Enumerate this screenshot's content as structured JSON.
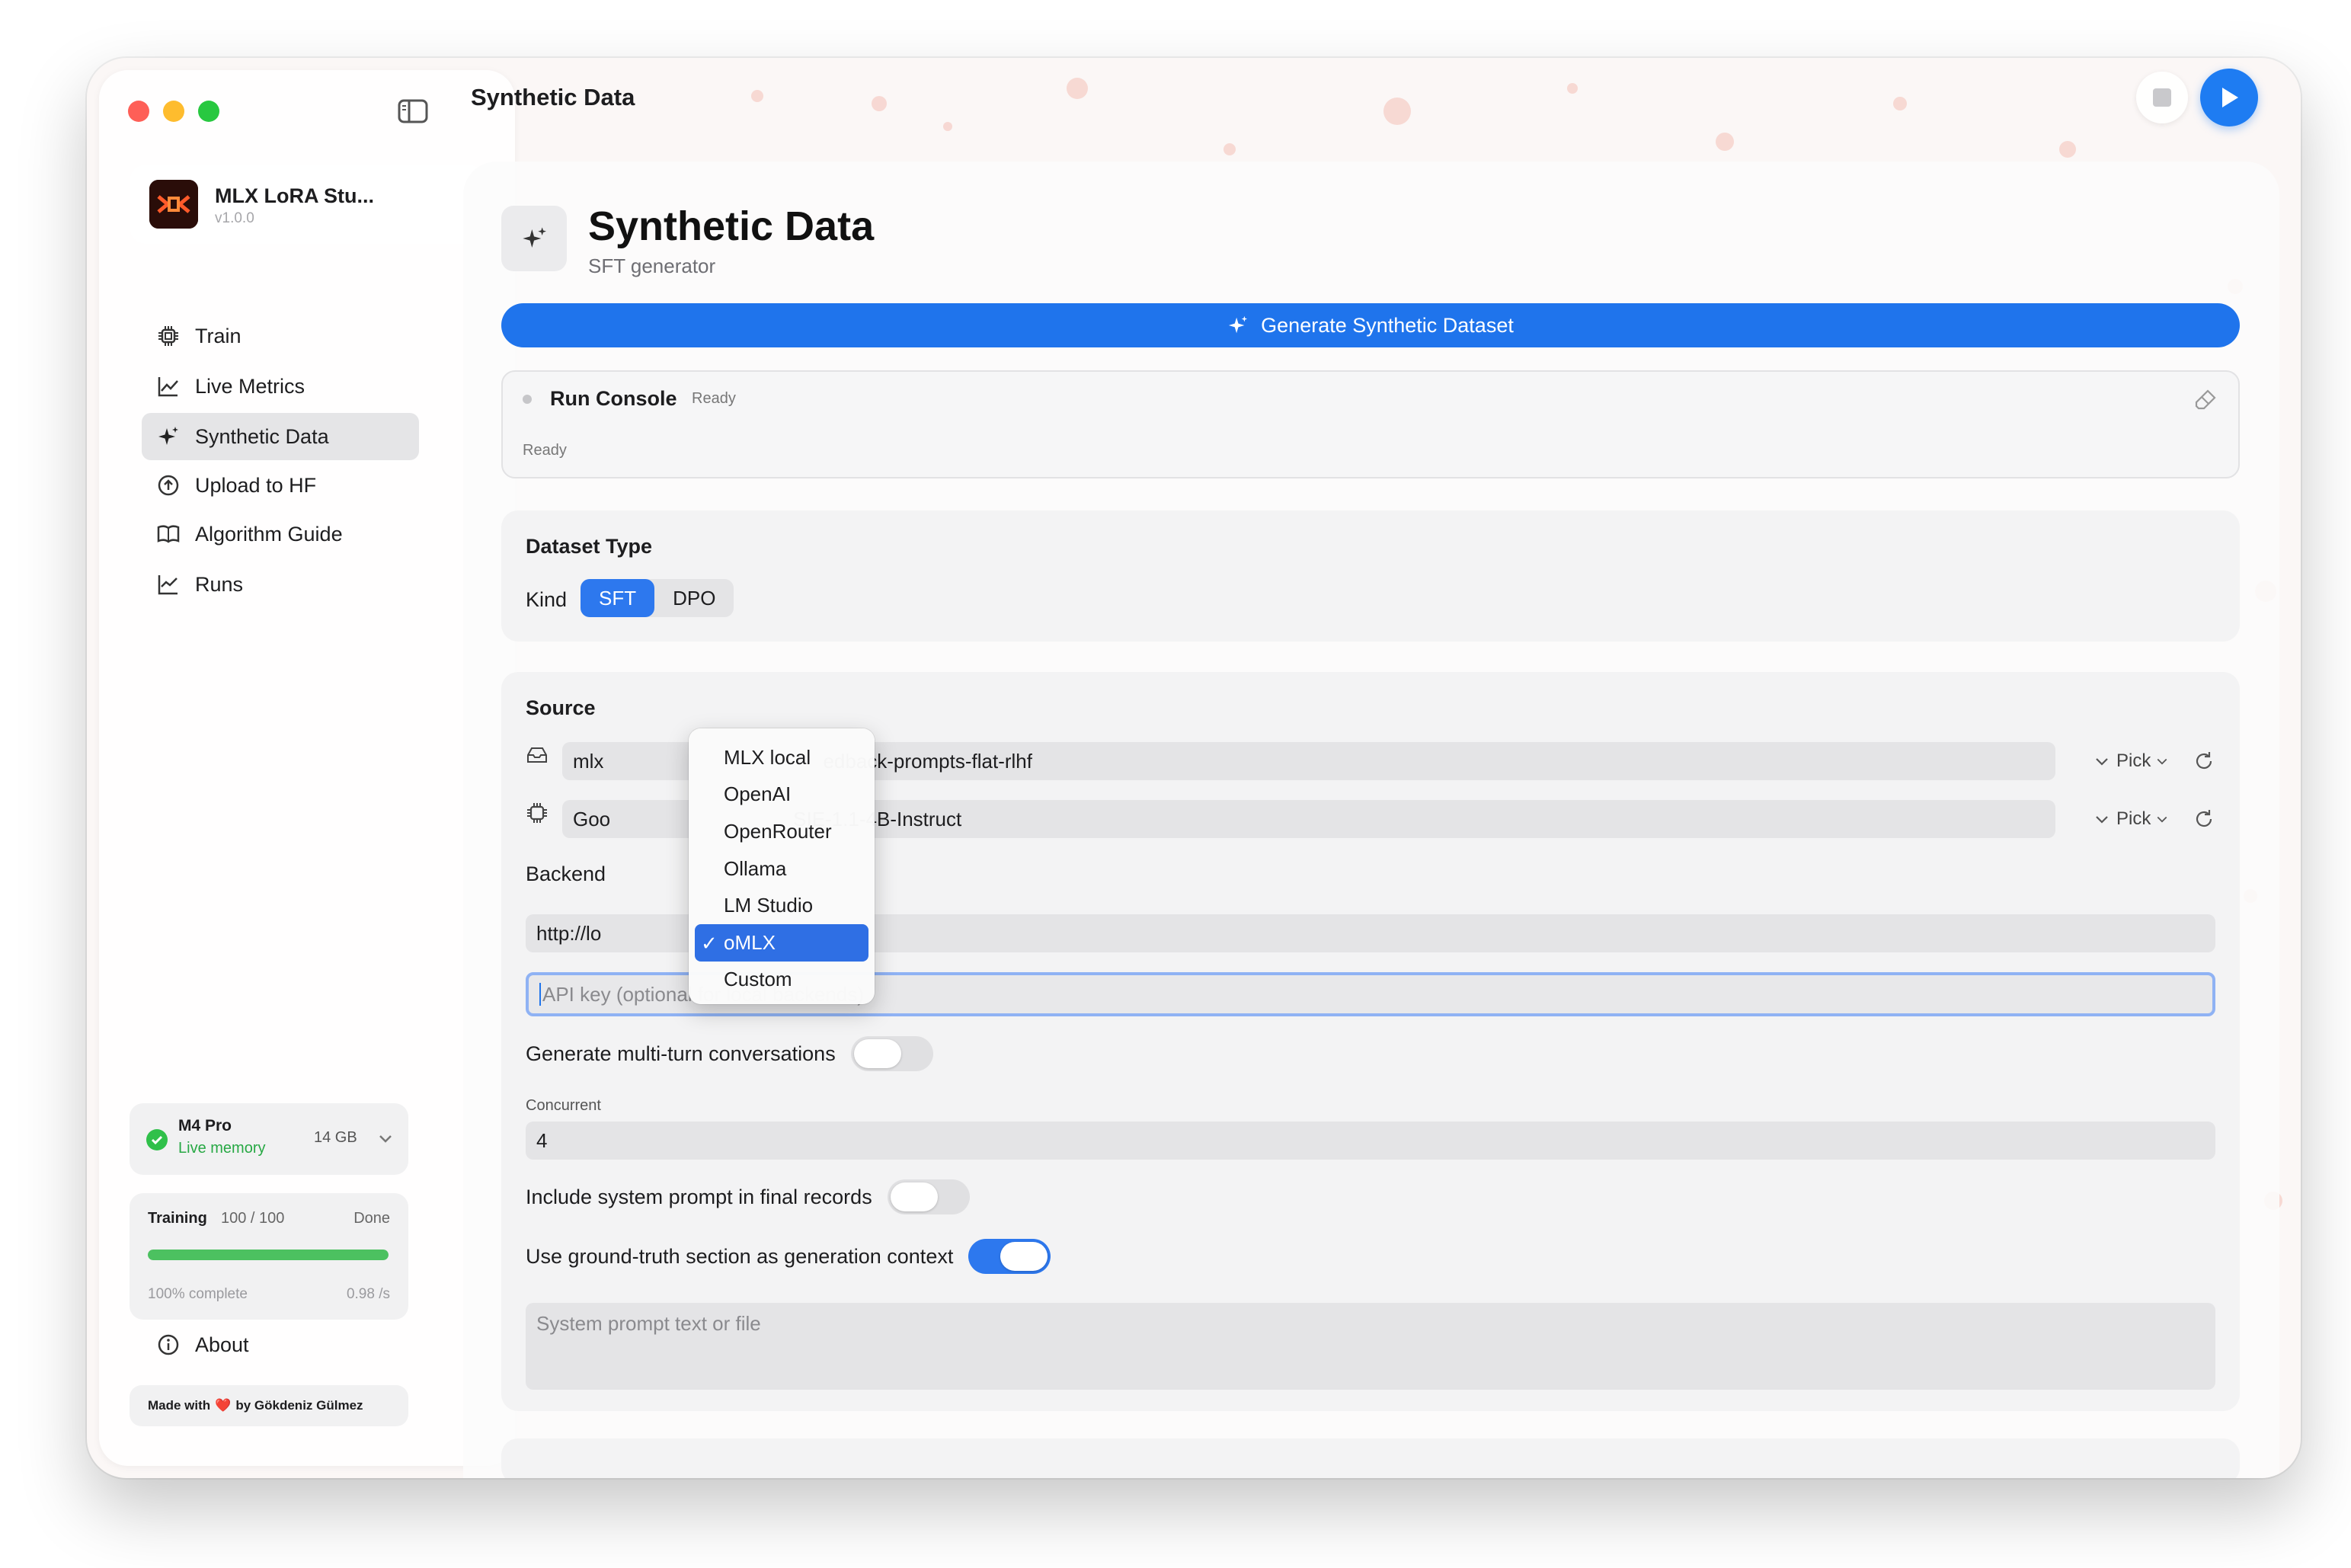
{
  "app": {
    "name": "MLX LoRA Stu...",
    "version": "v1.0.0",
    "toolbar_title": "Synthetic Data"
  },
  "sidebar": {
    "items": [
      {
        "label": "Train",
        "icon": "cpu-icon"
      },
      {
        "label": "Live Metrics",
        "icon": "chart-line-icon"
      },
      {
        "label": "Synthetic Data",
        "icon": "sparkles-icon",
        "active": true
      },
      {
        "label": "Upload to HF",
        "icon": "upload-circle-icon"
      },
      {
        "label": "Algorithm Guide",
        "icon": "book-icon"
      },
      {
        "label": "Runs",
        "icon": "chart-icon"
      }
    ],
    "memory": {
      "title": "M4 Pro",
      "subtitle": "Live memory",
      "size": "14 GB"
    },
    "training": {
      "title": "Training",
      "count": "100 / 100",
      "status": "Done",
      "progress": 1.0,
      "percent_text": "100% complete",
      "rate": "0.98 /s"
    },
    "about_label": "About",
    "made_with": {
      "prefix": "Made with",
      "heart": "❤️",
      "suffix": "by Gökdeniz Gülmez"
    }
  },
  "page": {
    "title": "Synthetic Data",
    "subtitle": "SFT generator",
    "generate_label": "Generate Synthetic Dataset"
  },
  "console": {
    "title": "Run Console",
    "status": "Ready",
    "log": "Ready"
  },
  "dataset_type": {
    "title": "Dataset Type",
    "kind_label": "Kind",
    "options": [
      "SFT",
      "DPO"
    ],
    "selected": "SFT"
  },
  "source": {
    "title": "Source",
    "dataset_field": {
      "visible_prefix": "mlx",
      "visible_suffix": "edback-prompts-flat-rlhf"
    },
    "model_field": {
      "visible_prefix": "Goo",
      "visible_suffix": "SIE-1.1-4B-Instruct"
    },
    "pick_label": "Pick",
    "backend_label": "Backend",
    "backend_options": [
      "MLX local",
      "OpenAI",
      "OpenRouter",
      "Ollama",
      "LM Studio",
      "oMLX",
      "Custom"
    ],
    "backend_selected": "oMLX",
    "base_url_visible": "http://lo",
    "api_key_placeholder": "API key (optional for local backends)",
    "multi_turn_label": "Generate multi-turn conversations",
    "multi_turn": false,
    "concurrent_label": "Concurrent",
    "concurrent_value": "4",
    "include_system_label": "Include system prompt in final records",
    "include_system": false,
    "ground_truth_label": "Use ground-truth section as generation context",
    "ground_truth": true,
    "system_prompt_placeholder": "System prompt text or file"
  },
  "colors": {
    "accent": "#1f74ec",
    "selected_menu": "#2f6fe4",
    "success": "#4cc160"
  }
}
